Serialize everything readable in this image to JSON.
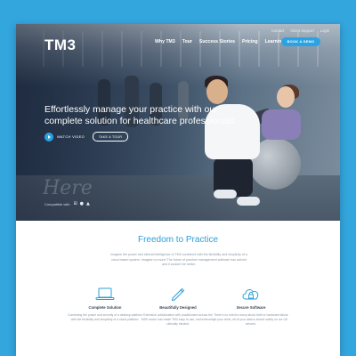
{
  "brand": {
    "logo": "TM3"
  },
  "utility_nav": [
    "Contact",
    "Client Support",
    "Login"
  ],
  "main_nav": [
    "Why TM3",
    "Tour",
    "Success Stories",
    "Pricing",
    "Learning"
  ],
  "cta": {
    "demo": "BOOK A DEMO"
  },
  "hero": {
    "headline": "Effortlessly manage your practice with our complete solution for healthcare professionals",
    "watch_video": "WATCH VIDEO",
    "take_tour": "TAKE A TOUR",
    "compatible_with": "Compatible with"
  },
  "section": {
    "title": "Freedom to Practice",
    "intro": "Imagine the power and clinical intelligence of TM3 combined with the flexibility and simplicity of a cloud based system. Imagine no more! The future of practice management software has arrived and it couldn't be better."
  },
  "features": [
    {
      "title": "Complete Solution",
      "desc": "Combining the power and security of a desktop platform with the flexibility and simplicity of a cloud platform.",
      "icon": "laptop-icon"
    },
    {
      "title": "Beautifully Designed",
      "desc": "Extensive collaboration with practitioners across the MSK sector has made TM3 easy to use, and extremely clinically minded.",
      "icon": "pencil-icon"
    },
    {
      "title": "Secure Software",
      "desc": "There's no need to worry about theft or hardware failure in your clinic, all of your data is stored safely on our UK servers.",
      "icon": "cloud-lock-icon"
    }
  ],
  "colors": {
    "accent": "#2ba3e3",
    "background": "#33a6de"
  }
}
